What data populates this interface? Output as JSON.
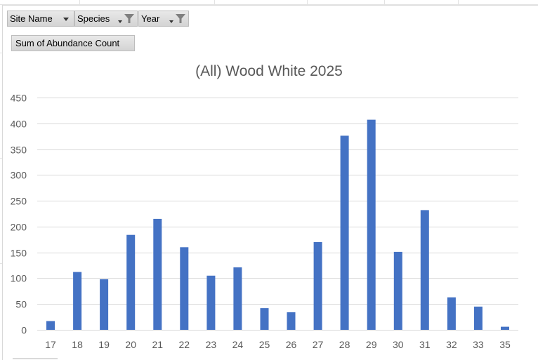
{
  "pivot": {
    "fields": [
      {
        "label": "Site Name",
        "filtered": false
      },
      {
        "label": "Species",
        "filtered": true
      },
      {
        "label": "Year",
        "filtered": true
      }
    ],
    "value_field": "Sum of Abundance Count"
  },
  "colors": {
    "bar": "#4472c4",
    "grid": "#d9d9d9",
    "text": "#595959"
  },
  "chart_data": {
    "type": "bar",
    "title": "(All) Wood White 2025",
    "categories": [
      "17",
      "18",
      "19",
      "20",
      "21",
      "22",
      "23",
      "24",
      "25",
      "26",
      "27",
      "28",
      "29",
      "30",
      "31",
      "32",
      "33",
      "35"
    ],
    "values": [
      17,
      112,
      98,
      184,
      215,
      160,
      105,
      121,
      42,
      34,
      170,
      376,
      407,
      151,
      232,
      63,
      45,
      6
    ],
    "ylim": [
      0,
      450
    ],
    "yticks": [
      0,
      50,
      100,
      150,
      200,
      250,
      300,
      350,
      400,
      450
    ],
    "grid": true,
    "legend": "none"
  }
}
